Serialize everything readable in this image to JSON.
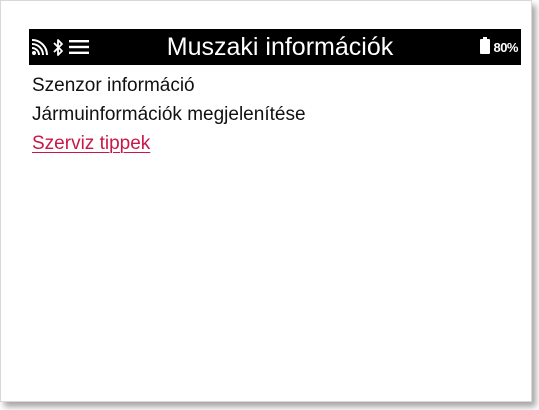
{
  "statusbar": {
    "title": "Muszaki információk",
    "battery_text": "80%",
    "icons": [
      "wifi-icon",
      "bluetooth-icon",
      "hamburger-menu-icon",
      "battery-icon"
    ]
  },
  "menu": {
    "items": [
      {
        "label": "Szenzor információ",
        "selected": false
      },
      {
        "label": "Jármuinformációk megjelenítése",
        "selected": false
      },
      {
        "label": "Szerviz tippek",
        "selected": true
      }
    ]
  },
  "colors": {
    "statusbar_bg": "#000000",
    "text": "#111111",
    "selected_text": "#c8174b"
  }
}
